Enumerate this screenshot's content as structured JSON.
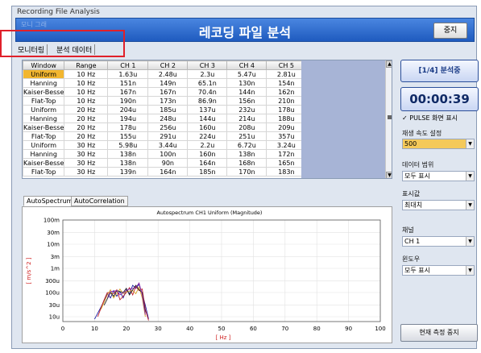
{
  "window": {
    "title": "Recording File Analysis"
  },
  "banner": {
    "ghost_text": "모니 그래",
    "title": "레코딩 파일 분석",
    "stop_label": "중지"
  },
  "tabs": [
    "모니터링",
    "분석 데이터"
  ],
  "grid": {
    "columns": [
      "Window",
      "Range",
      "CH 1",
      "CH 2",
      "CH 3",
      "CH 4",
      "CH 5"
    ],
    "rows": [
      [
        "Uniform",
        "10 Hz",
        "1.63u",
        "2.48u",
        "2.3u",
        "5.47u",
        "2.81u"
      ],
      [
        "Hanning",
        "10 Hz",
        "151n",
        "149n",
        "65.1n",
        "130n",
        "154n"
      ],
      [
        "Kaiser-Besse",
        "10 Hz",
        "167n",
        "167n",
        "70.4n",
        "144n",
        "162n"
      ],
      [
        "Flat-Top",
        "10 Hz",
        "190n",
        "173n",
        "86.9n",
        "156n",
        "210n"
      ],
      [
        "Uniform",
        "20 Hz",
        "204u",
        "185u",
        "137u",
        "232u",
        "178u"
      ],
      [
        "Hanning",
        "20 Hz",
        "194u",
        "248u",
        "144u",
        "214u",
        "188u"
      ],
      [
        "Kaiser-Besse",
        "20 Hz",
        "178u",
        "256u",
        "160u",
        "208u",
        "209u"
      ],
      [
        "Flat-Top",
        "20 Hz",
        "155u",
        "291u",
        "224u",
        "251u",
        "357u"
      ],
      [
        "Uniform",
        "30 Hz",
        "5.98u",
        "3.44u",
        "2.2u",
        "6.72u",
        "3.24u"
      ],
      [
        "Hanning",
        "30 Hz",
        "138n",
        "100n",
        "160n",
        "138n",
        "172n"
      ],
      [
        "Kaiser-Besse",
        "30 Hz",
        "138n",
        "90n",
        "164n",
        "168n",
        "165n"
      ],
      [
        "Flat-Top",
        "30 Hz",
        "139n",
        "164n",
        "185n",
        "170n",
        "183n"
      ]
    ]
  },
  "chart_tabs": [
    "AutoSpectrum",
    "AutoCorrelation"
  ],
  "chart_data": {
    "type": "line",
    "title": "Autospectrum CH1 Uniform (Magnitude)",
    "xlabel": "[ Hz ]",
    "ylabel": "[ m/s^2 ]",
    "x_ticks": [
      "0",
      "10",
      "20",
      "30",
      "40",
      "50",
      "60",
      "70",
      "80",
      "90",
      "100"
    ],
    "y_ticks": [
      "100m",
      "30m",
      "10m",
      "3m",
      "1m",
      "300u",
      "100u",
      "30u",
      "10u"
    ],
    "xlim": [
      0,
      100
    ],
    "ylim_log10": [
      -5.2,
      -1
    ],
    "series": [
      {
        "color": "#1a1aa0",
        "x": [
          10,
          12,
          14,
          15,
          16,
          17,
          18,
          19,
          20,
          21,
          22,
          23,
          24,
          25,
          26,
          27
        ],
        "y": [
          8e-06,
          2.5e-05,
          9e-05,
          6e-05,
          0.00012,
          7e-05,
          0.00011,
          6e-05,
          0.00013,
          9e-05,
          0.0002,
          0.00015,
          0.00022,
          9e-05,
          3e-05,
          8e-06
        ]
      },
      {
        "color": "#c0202a",
        "x": [
          11,
          13,
          14,
          16,
          17,
          18,
          20,
          21,
          22,
          23,
          24,
          25,
          26,
          27
        ],
        "y": [
          1e-05,
          5e-05,
          0.0001,
          9e-05,
          0.00013,
          5e-05,
          0.0001,
          0.00016,
          8e-05,
          0.00018,
          0.00012,
          0.00014,
          2e-05,
          7e-06
        ]
      },
      {
        "color": "#d4a020",
        "x": [
          12,
          14,
          15,
          16,
          18,
          19,
          20,
          22,
          23,
          24,
          25,
          26
        ],
        "y": [
          2e-05,
          8e-05,
          0.00013,
          6e-05,
          0.00014,
          9e-05,
          0.00011,
          0.00012,
          9e-05,
          0.00017,
          6e-05,
          1e-05
        ]
      },
      {
        "color": "#202020",
        "x": [
          13,
          15,
          16,
          17,
          19,
          20,
          21,
          22,
          23,
          24,
          25,
          26
        ],
        "y": [
          3e-05,
          0.0001,
          7e-05,
          0.00012,
          0.0001,
          0.00015,
          8e-05,
          0.00013,
          0.0002,
          0.00013,
          0.0001,
          1.5e-05
        ]
      },
      {
        "color": "#8a2aa8",
        "x": [
          14,
          15,
          17,
          18,
          20,
          21,
          23,
          24,
          25,
          26
        ],
        "y": [
          6e-05,
          0.00011,
          0.00012,
          8e-05,
          0.00012,
          0.00014,
          0.00016,
          0.00025,
          8e-05,
          1.2e-05
        ]
      }
    ]
  },
  "right_panel": {
    "status": "[1/4] 분석중",
    "timer": "00:00:39",
    "pulse_label": "PULSE 화면 표시",
    "speed_label": "재생 속도 설정",
    "speed_value": "500",
    "range_label": "데이터 범위",
    "range_value": "모두 표시",
    "display_label": "표시값",
    "display_value": "최대치",
    "channel_label": "채널",
    "channel_value": "CH 1",
    "window_label": "윈도우",
    "window_value": "모두 표시",
    "stop_measure_label": "현재 측정 중지"
  }
}
